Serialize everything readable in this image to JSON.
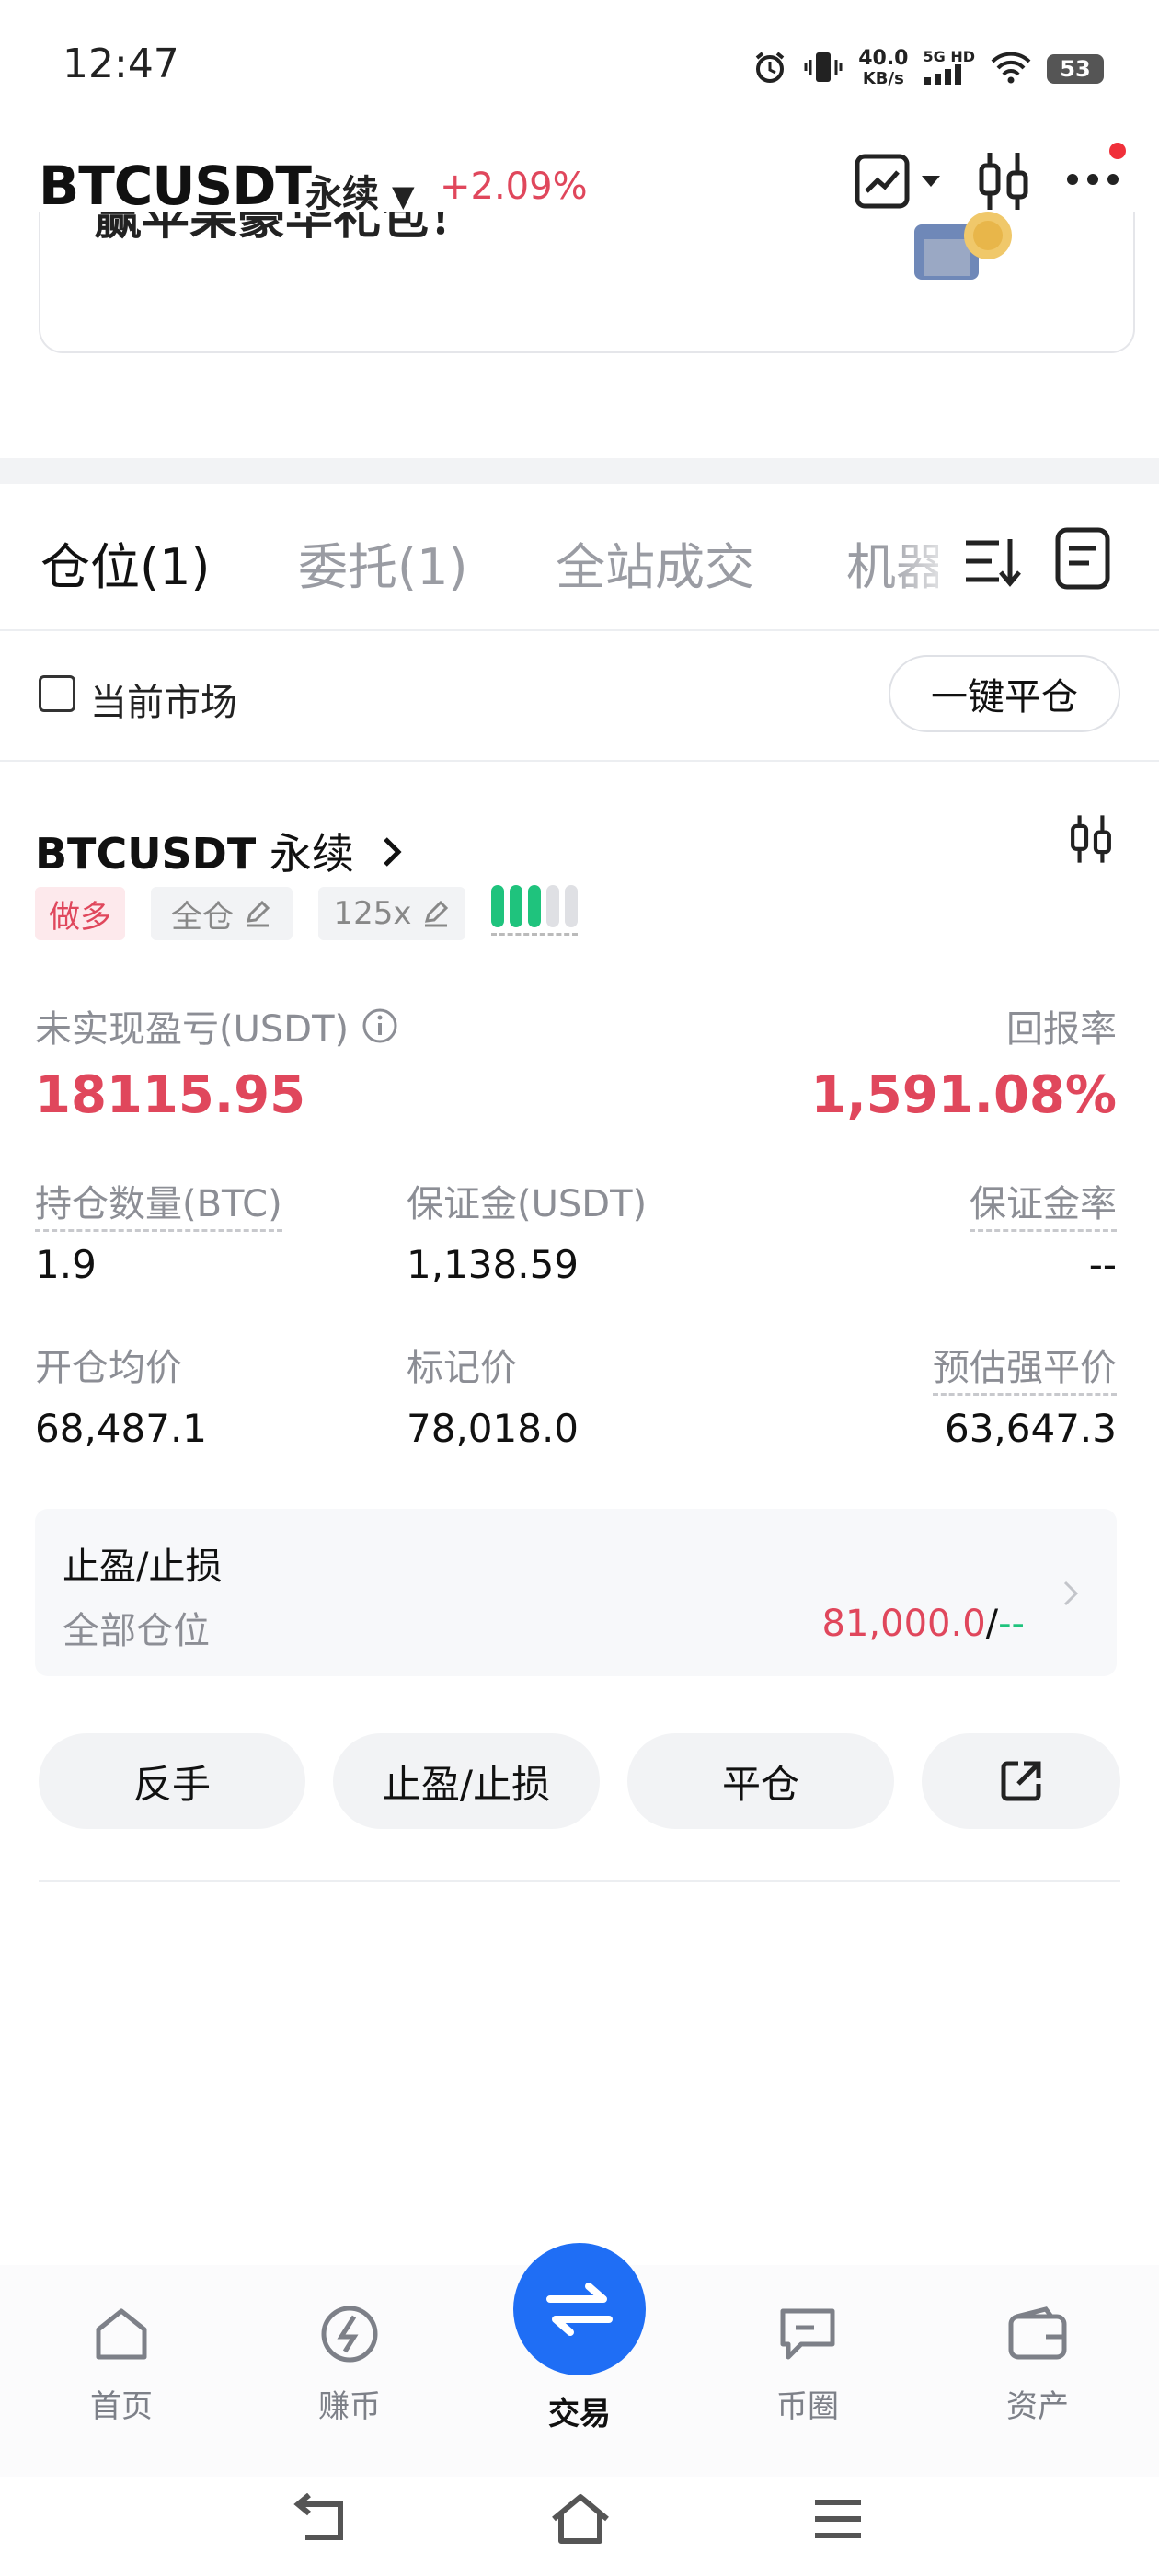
{
  "status_bar": {
    "time": "12:47",
    "net_speed": "40.0",
    "net_unit": "KB/s",
    "net_type": "5G HD",
    "battery": "53"
  },
  "header": {
    "pair": "BTCUSDT",
    "contract": "永续",
    "change": "+2.09%"
  },
  "banner": {
    "text": "赢苹果豪华礼包！"
  },
  "tabs": [
    {
      "label": "仓位(1)",
      "active": true
    },
    {
      "label": "委托(1)"
    },
    {
      "label": "全站成交"
    },
    {
      "label": "机器"
    }
  ],
  "filter": {
    "current_market_label": "当前市场",
    "close_all_label": "一键平仓"
  },
  "position": {
    "symbol": "BTCUSDT",
    "contract": "永续",
    "side_tag": "做多",
    "margin_mode": "全仓",
    "leverage": "125x",
    "unrealized_pnl_label": "未实现盈亏(USDT)",
    "unrealized_pnl": "18115.95",
    "roe_label": "回报率",
    "roe": "1,591.08%",
    "size_label": "持仓数量(BTC)",
    "size": "1.9",
    "margin_label": "保证金(USDT)",
    "margin": "1,138.59",
    "margin_ratio_label": "保证金率",
    "margin_ratio": "--",
    "entry_label": "开仓均价",
    "entry": "68,487.1",
    "mark_label": "标记价",
    "mark": "78,018.0",
    "liq_label": "预估强平价",
    "liq": "63,647.3",
    "tpsl": {
      "title": "止盈/止损",
      "scope": "全部仓位",
      "tp": "81,000.0",
      "sep": "/",
      "sl": "--"
    },
    "buttons": {
      "reverse": "反手",
      "tpsl": "止盈/止损",
      "close": "平仓"
    }
  },
  "nav": {
    "home": "首页",
    "earn": "赚币",
    "trade": "交易",
    "square": "币圈",
    "assets": "资产"
  },
  "colors": {
    "red": "#e0475c",
    "green": "#1fc37d",
    "blue": "#1f6ef5"
  }
}
